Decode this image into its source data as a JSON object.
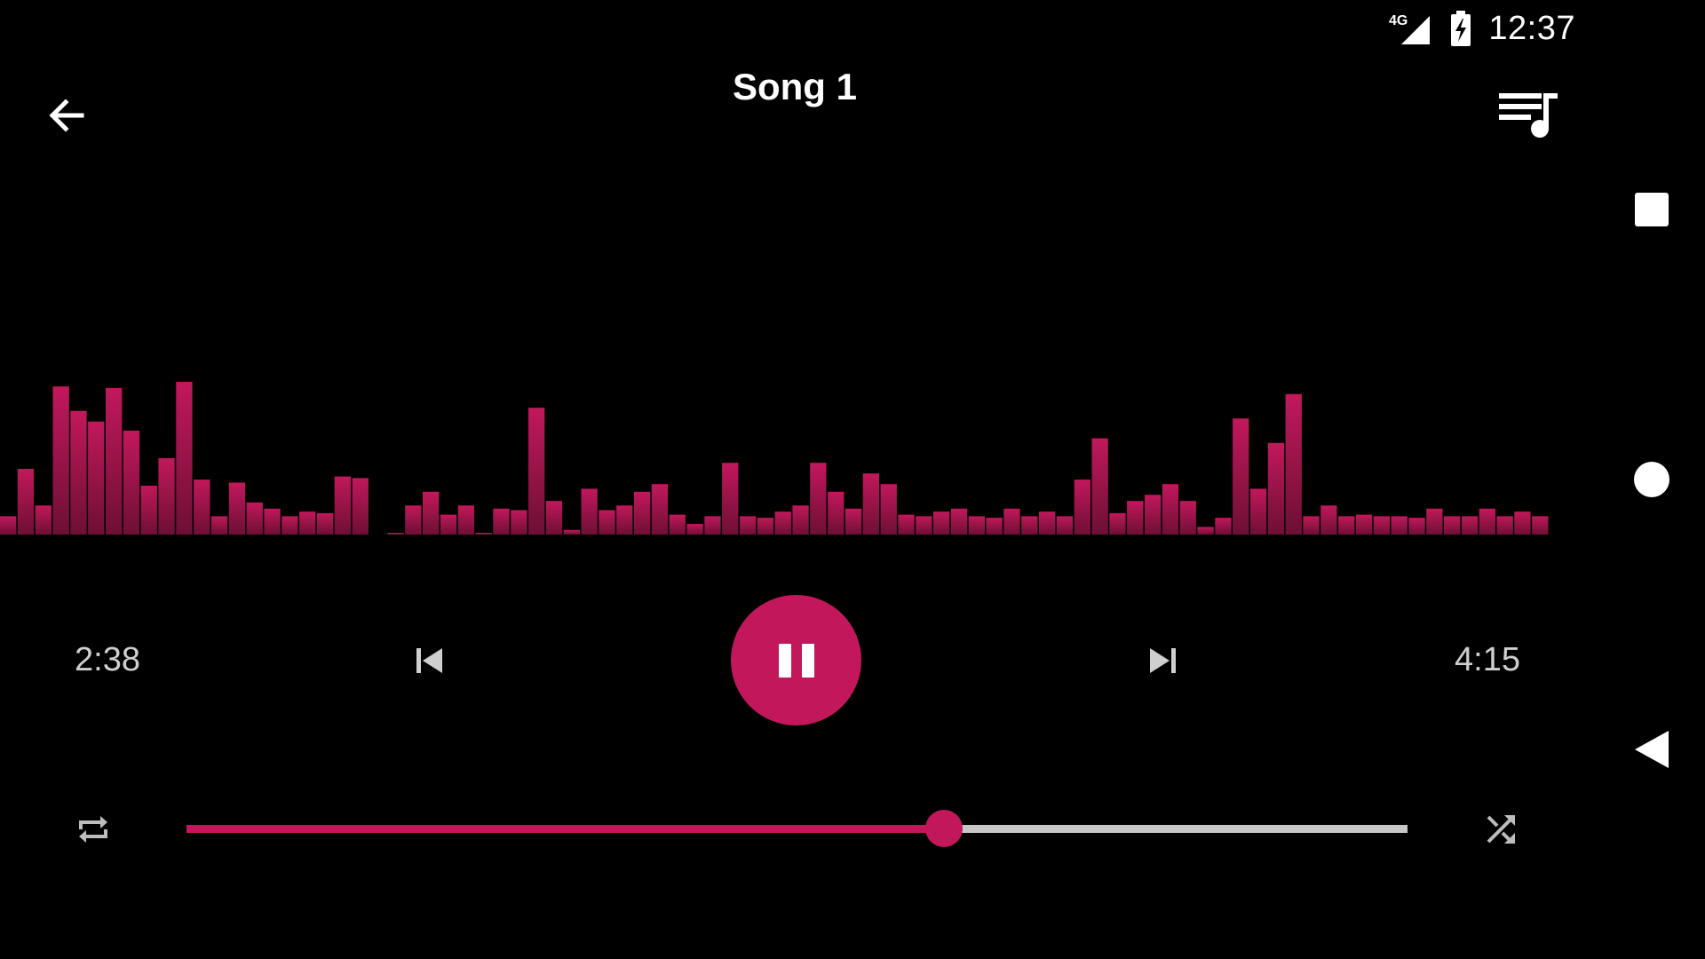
{
  "status_bar": {
    "network_label": "4G",
    "time": "12:37",
    "icons": [
      "signal-icon",
      "battery-charging-icon"
    ]
  },
  "toolbar": {
    "title": "Song 1",
    "back_icon": "arrow-back-icon",
    "queue_icon": "queue-music-icon"
  },
  "player": {
    "elapsed": "2:38",
    "total": "4:15",
    "progress_fraction": 0.62,
    "state": "playing",
    "icons": {
      "previous": "skip-previous-icon",
      "next": "skip-next-icon",
      "pause": "pause-icon",
      "repeat": "repeat-icon",
      "shuffle": "shuffle-icon"
    }
  },
  "visualizer": {
    "levels": [
      0.12,
      0.43,
      0.19,
      0.97,
      0.81,
      0.74,
      0.96,
      0.68,
      0.32,
      0.5,
      1.0,
      0.36,
      0.12,
      0.34,
      0.21,
      0.17,
      0.12,
      0.15,
      0.14,
      0.38,
      0.37,
      0.0,
      0.19,
      0.28,
      0.13,
      0.19,
      0.01,
      0.17,
      0.16,
      0.83,
      0.22,
      0.03,
      0.3,
      0.16,
      0.19,
      0.28,
      0.33,
      0.13,
      0.07,
      0.12,
      0.47,
      0.12,
      0.11,
      0.15,
      0.19,
      0.47,
      0.28,
      0.17,
      0.4,
      0.33,
      0.13,
      0.12,
      0.15,
      0.17,
      0.12,
      0.11,
      0.17,
      0.12,
      0.15,
      0.12,
      0.36,
      0.63,
      0.14,
      0.22,
      0.26,
      0.33,
      0.22,
      0.05,
      0.11,
      0.76,
      0.3,
      0.6,
      0.92,
      0.12,
      0.19,
      0.12,
      0.13,
      0.12,
      0.12,
      0.11,
      0.17,
      0.12,
      0.12,
      0.17,
      0.12,
      0.15,
      0.12
    ],
    "gap_after_index": 20,
    "color": "#c2185b"
  },
  "navigation": {
    "recents_icon": "square-recents-icon",
    "home_icon": "circle-home-icon",
    "back_icon": "triangle-back-icon"
  },
  "colors": {
    "accent": "#c2185b",
    "background": "#000000",
    "track": "#c7c7c7"
  }
}
